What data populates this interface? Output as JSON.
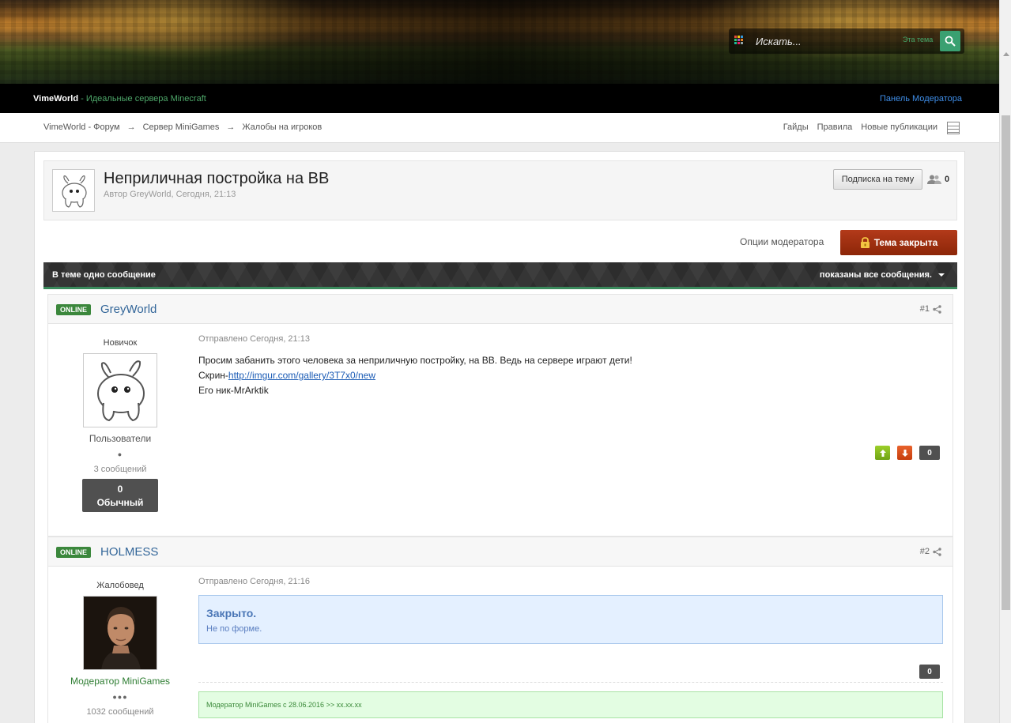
{
  "header": {
    "search_placeholder": "Искать...",
    "search_scope": "Эта тема",
    "brand": "VimeWorld",
    "tagline": "- Идеальные сервера Minecraft",
    "mod_panel": "Панель Модератора"
  },
  "breadcrumb": {
    "items": [
      "VimeWorld - Форум",
      "Сервер MiniGames",
      "Жалобы на игроков"
    ],
    "separator": "→",
    "links": [
      "Гайды",
      "Правила",
      "Новые публикации"
    ]
  },
  "topic": {
    "title": "Неприличная постройка на ВВ",
    "meta": "Автор GreyWorld, Сегодня, 21:13",
    "subscribe_label": "Подписка на тему",
    "followers_count": "0",
    "mod_options_label": "Опции модератора",
    "closed_label": "Тема закрыта"
  },
  "thread_bar": {
    "left": "В теме одно сообщение",
    "right": "показаны все сообщения."
  },
  "posts": [
    {
      "online": "ONLINE",
      "author": "GreyWorld",
      "number": "#1",
      "rank": "Новичок",
      "group": "Пользователи",
      "pips": "●",
      "post_count": "3 сообщений",
      "rep_value": "0",
      "rep_label": "Обычный",
      "date": "Отправлено Сегодня, 21:13",
      "line1": "Просим забанить этого человека за неприличную постройку, на ВВ. Ведь на сервере играют дети!",
      "line2_prefix": "Скрин-",
      "line2_link": "http://imgur.com/gallery/3T7x0/new",
      "line3": "Его ник-MrArktik",
      "score": "0"
    },
    {
      "online": "ONLINE",
      "author": "HOLMESS",
      "number": "#2",
      "rank": "Жалобовед",
      "group": "Модератор MiniGames",
      "pips": "●●●",
      "post_count": "1032 сообщений",
      "date": "Отправлено Сегодня, 21:16",
      "quote_title": "Закрыто.",
      "quote_sub": "Не по форме.",
      "score": "0",
      "signature": "Модератор MiniGames с 28.06.2016 >> xx.xx.xx"
    }
  ],
  "colors": {
    "accent_green": "#3b873c",
    "closed_red": "#9e2f10",
    "link_blue": "#336699"
  }
}
